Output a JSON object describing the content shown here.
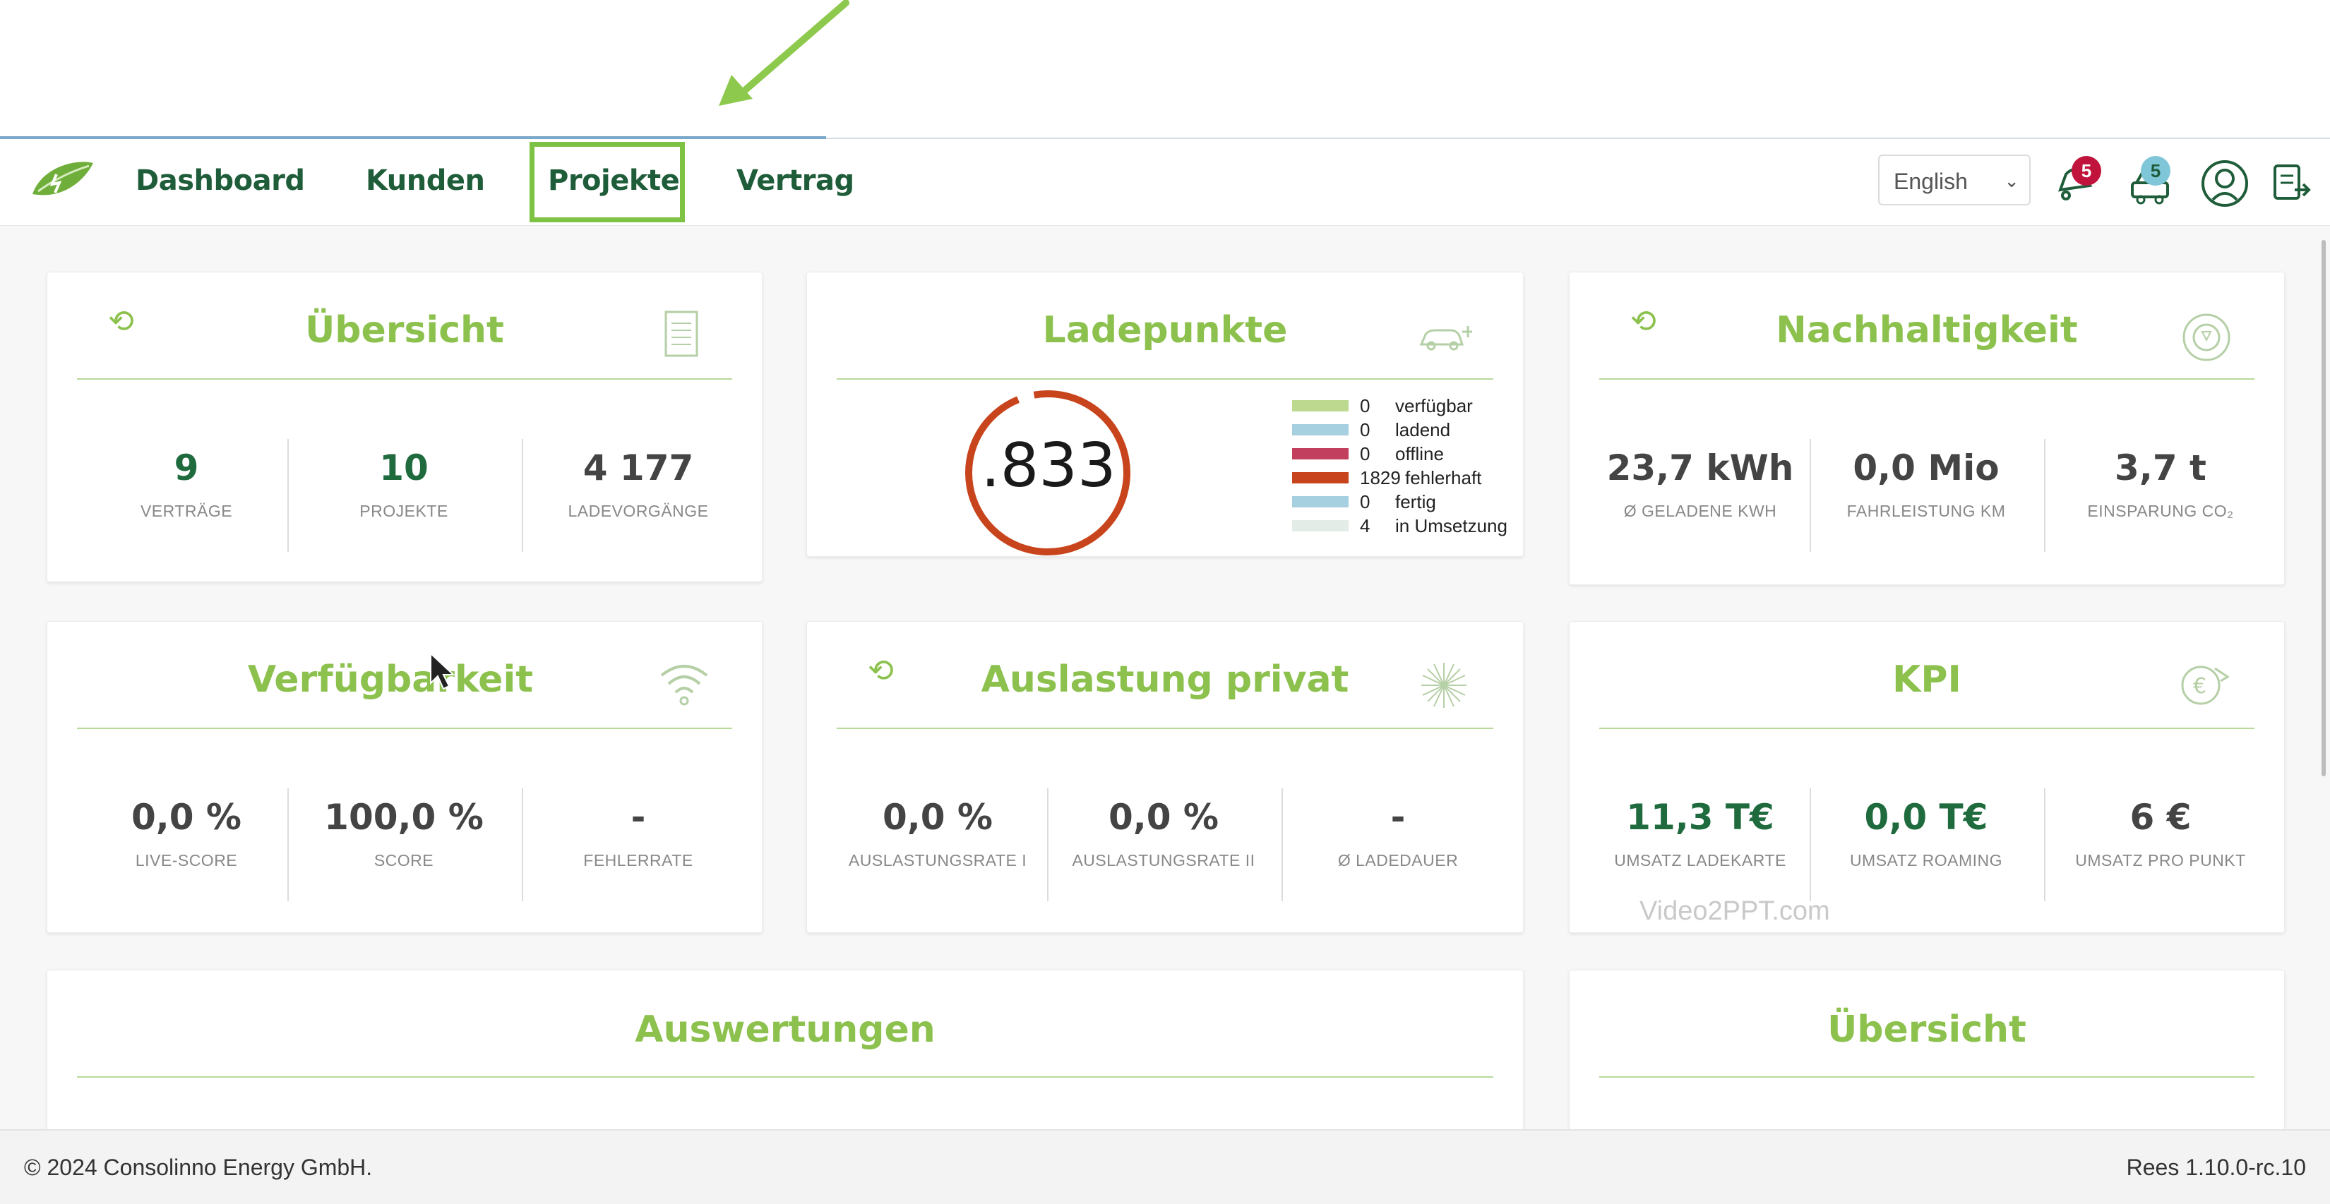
{
  "nav": {
    "items": [
      "Dashboard",
      "Kunden",
      "Projekte",
      "Vertrag"
    ],
    "language": "English",
    "notifications_count": "5",
    "tasks_count": "5"
  },
  "cards": {
    "uebersicht": {
      "title": "Übersicht",
      "stats": [
        {
          "value": "9",
          "label": "VERTRÄGE"
        },
        {
          "value": "10",
          "label": "PROJEKTE"
        },
        {
          "value": "4 177",
          "label": "LADEVORGÄNGE"
        }
      ]
    },
    "ladepunkte": {
      "title": "Ladepunkte",
      "total": ".833",
      "legend": [
        {
          "count": "0",
          "label": "verfügbar",
          "color": "#bcd98f"
        },
        {
          "count": "0",
          "label": "ladend",
          "color": "#a6cfe0"
        },
        {
          "count": "0",
          "label": "offline",
          "color": "#c2405e"
        },
        {
          "count": "1829",
          "label": "fehlerhaft",
          "color": "#c8441c"
        },
        {
          "count": "0",
          "label": "fertig",
          "color": "#a6cfe0"
        },
        {
          "count": "4",
          "label": "in Umsetzung",
          "color": "#e3ece6"
        }
      ]
    },
    "nachhaltigkeit": {
      "title": "Nachhaltigkeit",
      "stats": [
        {
          "value": "23,7 kWh",
          "label": "Ø GELADENE KWH"
        },
        {
          "value": "0,0 Mio",
          "label": "FAHRLEISTUNG KM"
        },
        {
          "value": "3,7 t",
          "label": "EINSPARUNG CO₂"
        }
      ]
    },
    "verfuegbarkeit": {
      "title": "Verfügbarkeit",
      "stats": [
        {
          "value": "0,0 %",
          "label": "LIVE-SCORE"
        },
        {
          "value": "100,0 %",
          "label": "SCORE"
        },
        {
          "value": "-",
          "label": "FEHLERRATE"
        }
      ]
    },
    "auslastung": {
      "title": "Auslastung privat",
      "stats": [
        {
          "value": "0,0 %",
          "label": "AUSLASTUNGSRATE I"
        },
        {
          "value": "0,0 %",
          "label": "AUSLASTUNGSRATE II"
        },
        {
          "value": "-",
          "label": "Ø LADEDAUER"
        }
      ]
    },
    "kpi": {
      "title": "KPI",
      "stats": [
        {
          "value": "11,3 T€",
          "label": "UMSATZ LADEKARTE"
        },
        {
          "value": "0,0 T€",
          "label": "UMSATZ ROAMING"
        },
        {
          "value": "6 €",
          "label": "UMSATZ PRO PUNKT"
        }
      ]
    },
    "auswertungen": {
      "title": "Auswertungen"
    },
    "uebersicht2": {
      "title": "Übersicht"
    }
  },
  "footer": {
    "copyright": "© 2024 Consolinno Energy GmbH.",
    "version": "Rees 1.10.0-rc.10"
  },
  "watermark": "Video2PPT.com",
  "colors": {
    "brand_green": "#8cc14e",
    "nav_text": "#1f5d3a",
    "highlight": "#7dc242",
    "donut": "#c8441c",
    "badge_red": "#c0143c",
    "badge_blue": "#7fc6d9"
  }
}
